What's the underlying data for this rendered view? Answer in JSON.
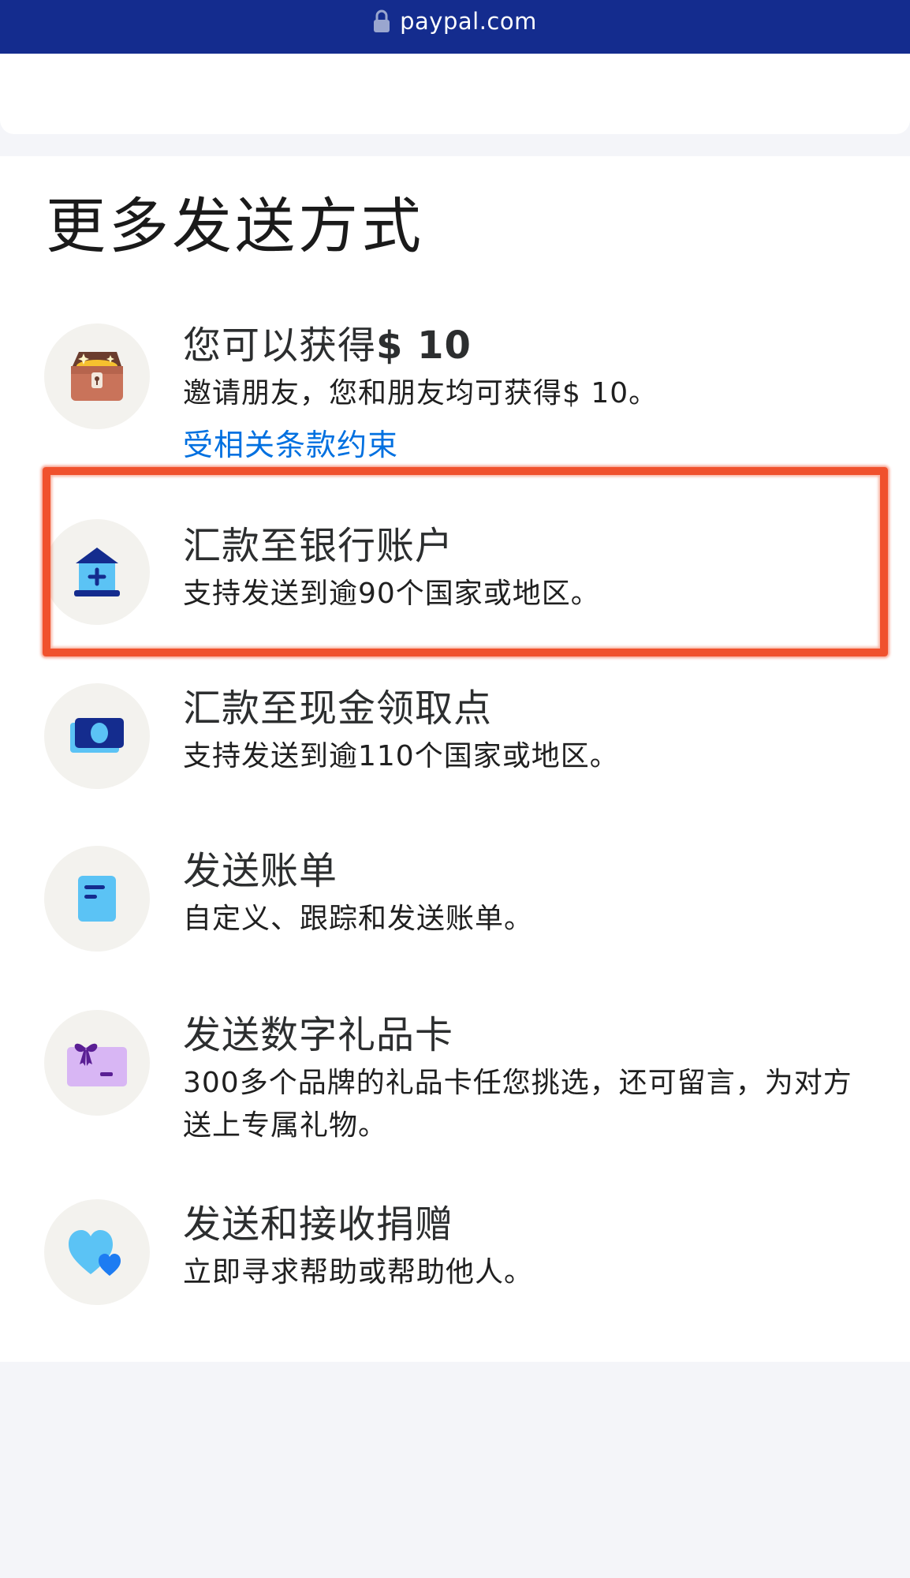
{
  "browser": {
    "url": "paypal.com"
  },
  "page": {
    "title": "更多发送方式"
  },
  "options": [
    {
      "title_prefix": "您可以获得",
      "title_amount": "$ 10",
      "description": "邀请朋友，您和朋友均可获得$ 10。",
      "link": "受相关条款约束",
      "icon": "treasure-chest-icon"
    },
    {
      "title": "汇款至银行账户",
      "description": "支持发送到逾90个国家或地区。",
      "icon": "bank-icon"
    },
    {
      "title": "汇款至现金领取点",
      "description": "支持发送到逾110个国家或地区。",
      "icon": "cash-icon"
    },
    {
      "title": "发送账单",
      "description": "自定义、跟踪和发送账单。",
      "icon": "invoice-icon"
    },
    {
      "title": "发送数字礼品卡",
      "description": "300多个品牌的礼品卡任您挑选，还可留言，为对方送上专属礼物。",
      "icon": "gift-card-icon"
    },
    {
      "title": "发送和接收捐赠",
      "description": "立即寻求帮助或帮助他人。",
      "icon": "hearts-icon"
    }
  ],
  "colors": {
    "header_bg": "#142c8e",
    "link": "#0070e0",
    "highlight": "#f0512d",
    "icon_bg": "#f3f2ee"
  }
}
